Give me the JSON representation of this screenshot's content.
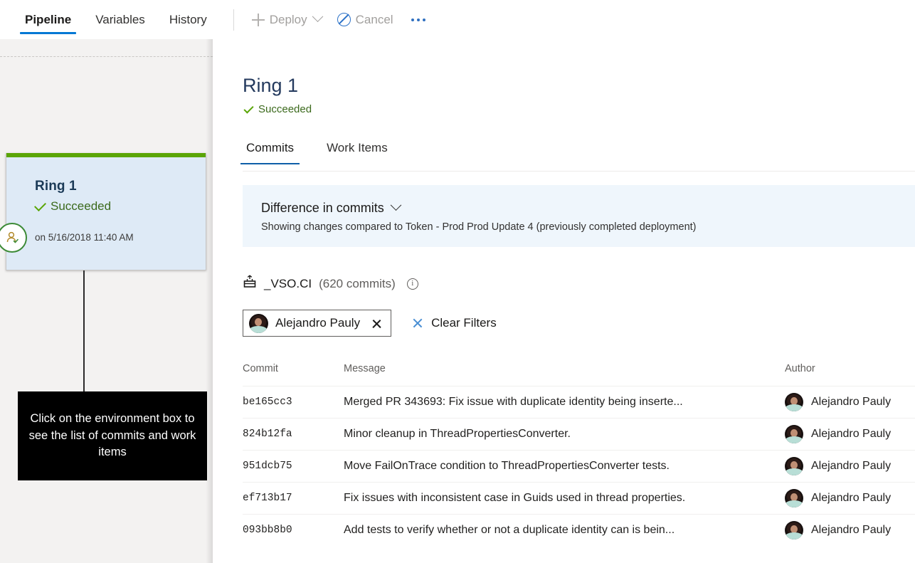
{
  "commandbar": {
    "tabs": [
      {
        "label": "Pipeline",
        "active": true
      },
      {
        "label": "Variables",
        "active": false
      },
      {
        "label": "History",
        "active": false
      }
    ],
    "deploy_label": "Deploy",
    "cancel_label": "Cancel",
    "more_label": "...",
    "icons": {
      "add": "plus-icon",
      "deploy_chevron": "chevron-down-icon",
      "cancel": "ban-circle-icon",
      "more": "ellipsis-icon"
    }
  },
  "pipeline": {
    "environment_card": {
      "name": "Ring 1",
      "status": "Succeeded",
      "timestamp": "on 5/16/2018 11:40 AM",
      "status_color": "#5aa506",
      "card_background": "#deeaf6",
      "badge_icon": "pre-approval-person-icon"
    },
    "tooltip": "Click on the environment box to see the list of commits and work items"
  },
  "detail": {
    "title": "Ring 1",
    "status": "Succeeded",
    "tabs": [
      {
        "label": "Commits",
        "active": true
      },
      {
        "label": "Work Items",
        "active": false
      }
    ],
    "banner": {
      "heading": "Difference in commits",
      "subtext": "Showing changes compared to Token - Prod Prod Update 4 (previously completed deployment)",
      "background": "#eff6fc",
      "chevron_icon": "chevron-down-icon"
    },
    "repo": {
      "icon": "build-artifact-icon",
      "name": "_VSO.CI",
      "count": "(620 commits)",
      "info_icon": "info-icon",
      "info_glyph": "i"
    },
    "filters": {
      "chip_name": "Alejandro Pauly",
      "chip_remove_icon": "close-icon",
      "clear_label": "Clear Filters",
      "clear_icon": "close-icon"
    },
    "table": {
      "headers": {
        "commit": "Commit",
        "message": "Message",
        "author": "Author"
      },
      "rows": [
        {
          "commit": "be165cc3",
          "message": "Merged PR 343693: Fix issue with duplicate identity being inserte...",
          "author": "Alejandro Pauly"
        },
        {
          "commit": "824b12fa",
          "message": "Minor cleanup in ThreadPropertiesConverter.",
          "author": "Alejandro Pauly"
        },
        {
          "commit": "951dcb75",
          "message": "Move FailOnTrace condition to ThreadPropertiesConverter tests.",
          "author": "Alejandro Pauly"
        },
        {
          "commit": "ef713b17",
          "message": "Fix issues with inconsistent case in Guids used in thread properties.",
          "author": "Alejandro Pauly"
        },
        {
          "commit": "093bb8b0",
          "message": "Add tests to verify whether or not a duplicate identity can is bein...",
          "author": "Alejandro Pauly"
        }
      ]
    }
  },
  "theme": {
    "accent": "#0078d4",
    "success": "#5aa506",
    "banner_bg": "#eff6fc",
    "card_bg": "#deeaf6",
    "panel_bg": "#f3f2f1"
  }
}
